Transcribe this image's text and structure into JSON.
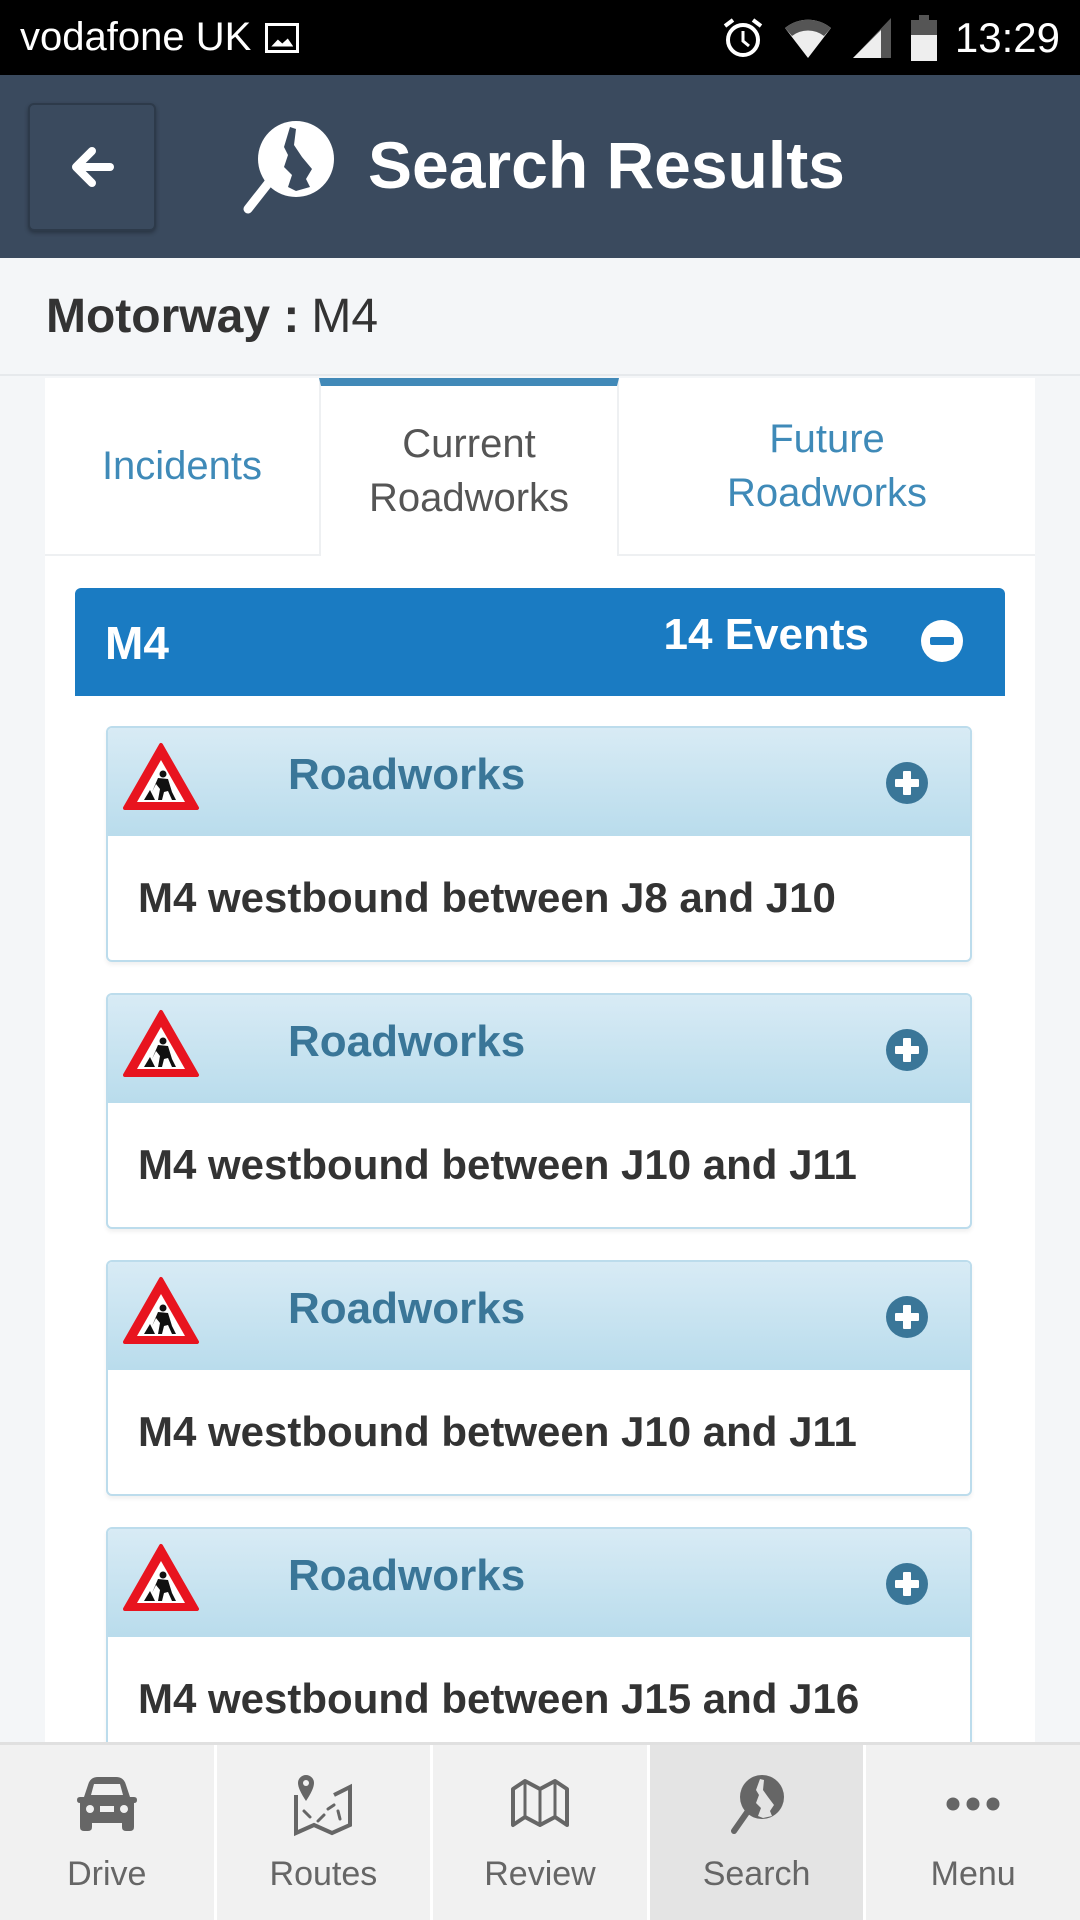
{
  "status_bar": {
    "carrier": "vodafone UK",
    "time": "13:29",
    "icons": [
      "image-notification-icon",
      "alarm-icon",
      "wifi-icon",
      "signal-icon",
      "battery-icon"
    ]
  },
  "header": {
    "back_icon": "arrow-left-icon",
    "title_icon": "uk-map-search-icon",
    "title": "Search Results"
  },
  "subheader": {
    "label": "Motorway :",
    "value": "M4"
  },
  "tabs": [
    {
      "label": "Incidents",
      "active": false
    },
    {
      "label": "Current Roadworks",
      "active": true
    },
    {
      "label": "Future Roadworks",
      "active": false
    }
  ],
  "group": {
    "title": "M4",
    "count_label": "14 Events",
    "toggle_icon": "minus-circle-icon"
  },
  "events": [
    {
      "type": "Roadworks",
      "description": "M4 westbound between J8 and J10",
      "icon": "roadworks-warning-icon"
    },
    {
      "type": "Roadworks",
      "description": "M4 westbound between J10 and J11",
      "icon": "roadworks-warning-icon"
    },
    {
      "type": "Roadworks",
      "description": "M4 westbound between J10 and J11",
      "icon": "roadworks-warning-icon"
    },
    {
      "type": "Roadworks",
      "description": "M4 westbound between J15 and J16",
      "icon": "roadworks-warning-icon"
    }
  ],
  "bottom_nav": [
    {
      "label": "Drive",
      "icon": "car-icon",
      "active": false
    },
    {
      "label": "Routes",
      "icon": "route-map-icon",
      "active": false
    },
    {
      "label": "Review",
      "icon": "folded-map-icon",
      "active": false
    },
    {
      "label": "Search",
      "icon": "uk-map-search-icon",
      "active": true
    },
    {
      "label": "Menu",
      "icon": "more-dots-icon",
      "active": false
    }
  ],
  "colors": {
    "header_bg": "#3a4a5e",
    "group_bg": "#1a7bc2",
    "tab_link": "#3f8ab8",
    "card_title": "#3a7698"
  }
}
